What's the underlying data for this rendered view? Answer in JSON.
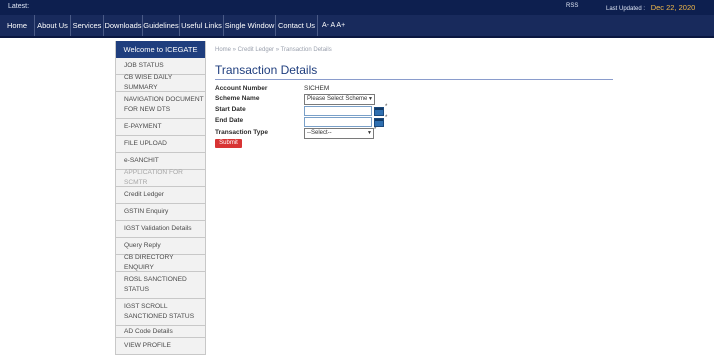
{
  "topbar": {
    "latest": "Latest:",
    "rss": "RSS",
    "last_updated_label": "Last Updated :",
    "last_updated_date": "Dec 22, 2020"
  },
  "nav": {
    "items": [
      "Home",
      "About Us",
      "Services",
      "Downloads",
      "Guidelines",
      "Useful Links",
      "Single Window",
      "Contact Us"
    ],
    "font_sizes": "A-  A  A+"
  },
  "sidebar": {
    "welcome": "Welcome to ICEGATE",
    "items": [
      "JOB STATUS",
      "CB WISE DAILY SUMMARY",
      "NAVIGATION DOCUMENT FOR NEW DTS",
      "E-PAYMENT",
      "FILE UPLOAD",
      "e-SANCHIT",
      "APPLICATION FOR SCMTR",
      "Credit Ledger",
      "GSTIN Enquiry",
      "IGST Validation Details",
      "Query Reply",
      "CB DIRECTORY ENQUIRY",
      "ROSL SANCTIONED STATUS",
      "IGST SCROLL SANCTIONED STATUS",
      "AD Code Details",
      "VIEW PROFILE"
    ]
  },
  "breadcrumb": "Home » Credit Ledger » Transaction Details",
  "page_title": "Transaction Details",
  "form": {
    "account_label": "Account Number",
    "account_value": "SICHEM",
    "scheme_label": "Scheme Name",
    "scheme_value": "Please Select Scheme",
    "start_label": "Start Date",
    "end_label": "End Date",
    "type_label": "Transaction Type",
    "type_value": "--Select--",
    "required_mark": "*",
    "submit_label": "Submit"
  }
}
